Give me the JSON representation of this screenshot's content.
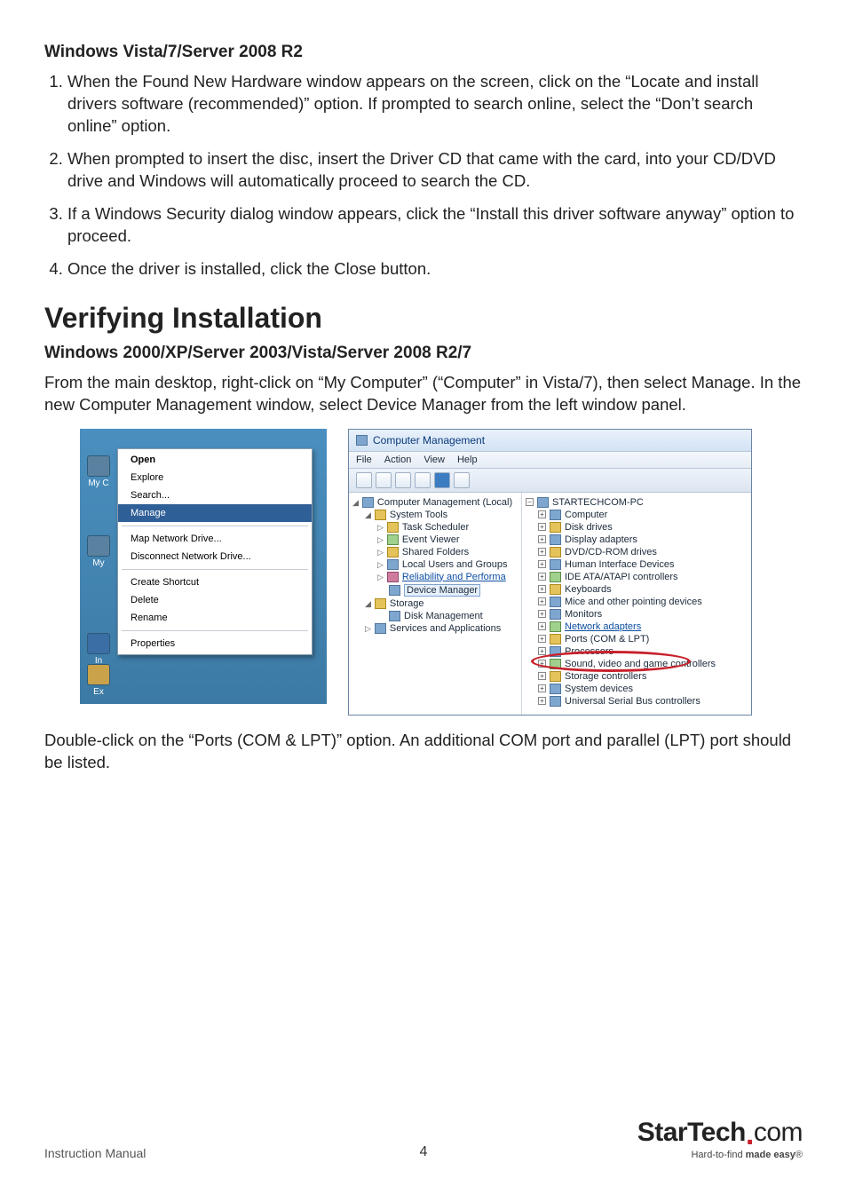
{
  "headings": {
    "vista": "Windows Vista/7/Server 2008 R2",
    "verify": "Verifying Installation",
    "verify_sub": "Windows 2000/XP/Server 2003/Vista/Server 2008 R2/7"
  },
  "steps": [
    "When the Found New Hardware window appears on the screen, click on the “Locate and install drivers software (recommended)” option. If prompted to search online, select the “Don’t search online” option.",
    "When prompted to insert the disc, insert the Driver CD that came with the card, into your CD/DVD drive and Windows will automatically proceed to search the CD.",
    "If a Windows Security dialog window appears, click the “Install this driver software anyway” option to proceed.",
    "Once the driver is installed, click the Close button."
  ],
  "verify_intro": "From the main desktop, right-click on “My Computer” (“Computer” in Vista/7), then select Manage. In the new Computer Management window, select Device Manager from the left window panel.",
  "verify_outro": "Double-click on the “Ports (COM & LPT)” option. An additional COM port and parallel (LPT) port should be listed.",
  "context_menu": {
    "desktop_icons": [
      "My C",
      "My",
      "In",
      "Ex"
    ],
    "groups": [
      [
        {
          "label": "Open",
          "bold": true
        },
        {
          "label": "Explore"
        },
        {
          "label": "Search..."
        },
        {
          "label": "Manage",
          "highlight": true
        }
      ],
      [
        {
          "label": "Map Network Drive..."
        },
        {
          "label": "Disconnect Network Drive..."
        }
      ],
      [
        {
          "label": "Create Shortcut"
        },
        {
          "label": "Delete"
        },
        {
          "label": "Rename"
        }
      ],
      [
        {
          "label": "Properties"
        }
      ]
    ]
  },
  "cm": {
    "title": "Computer Management",
    "menubar": [
      "File",
      "Action",
      "View",
      "Help"
    ],
    "left_tree": [
      {
        "indent": 0,
        "icon": "b",
        "label": "Computer Management (Local)",
        "exp": "tri-open"
      },
      {
        "indent": 1,
        "icon": "s",
        "label": "System Tools",
        "exp": "tri-open"
      },
      {
        "indent": 2,
        "icon": "s",
        "label": "Task Scheduler",
        "exp": "tri"
      },
      {
        "indent": 2,
        "icon": "g",
        "label": "Event Viewer",
        "exp": "tri"
      },
      {
        "indent": 2,
        "icon": "s",
        "label": "Shared Folders",
        "exp": "tri"
      },
      {
        "indent": 2,
        "icon": "b",
        "label": "Local Users and Groups",
        "exp": "tri"
      },
      {
        "indent": 2,
        "icon": "r",
        "label": "Reliability and Performa",
        "link": true,
        "exp": "tri"
      },
      {
        "indent": 2,
        "icon": "b",
        "label": "Device Manager",
        "selected": true
      },
      {
        "indent": 1,
        "icon": "s",
        "label": "Storage",
        "exp": "tri-open"
      },
      {
        "indent": 2,
        "icon": "b",
        "label": "Disk Management"
      },
      {
        "indent": 1,
        "icon": "b",
        "label": "Services and Applications",
        "exp": "tri"
      }
    ],
    "right_root": "STARTECHCOM-PC",
    "right_tree": [
      {
        "icon": "b",
        "label": "Computer"
      },
      {
        "icon": "s",
        "label": "Disk drives"
      },
      {
        "icon": "b",
        "label": "Display adapters"
      },
      {
        "icon": "s",
        "label": "DVD/CD-ROM drives"
      },
      {
        "icon": "b",
        "label": "Human Interface Devices"
      },
      {
        "icon": "g",
        "label": "IDE ATA/ATAPI controllers"
      },
      {
        "icon": "s",
        "label": "Keyboards"
      },
      {
        "icon": "b",
        "label": "Mice and other pointing devices"
      },
      {
        "icon": "b",
        "label": "Monitors"
      },
      {
        "icon": "g",
        "label": "Network adapters",
        "link": true
      },
      {
        "icon": "s",
        "label": "Ports (COM & LPT)",
        "highlight": true
      },
      {
        "icon": "b",
        "label": "Processors"
      },
      {
        "icon": "g",
        "label": "Sound, video and game controllers"
      },
      {
        "icon": "s",
        "label": "Storage controllers"
      },
      {
        "icon": "b",
        "label": "System devices"
      },
      {
        "icon": "b",
        "label": "Universal Serial Bus controllers"
      }
    ]
  },
  "footer": {
    "left": "Instruction Manual",
    "page": "4",
    "brand_a": "StarTech",
    "brand_b": "com",
    "tagline_a": "Hard-to-find ",
    "tagline_b": "made easy",
    "reg": "®"
  }
}
